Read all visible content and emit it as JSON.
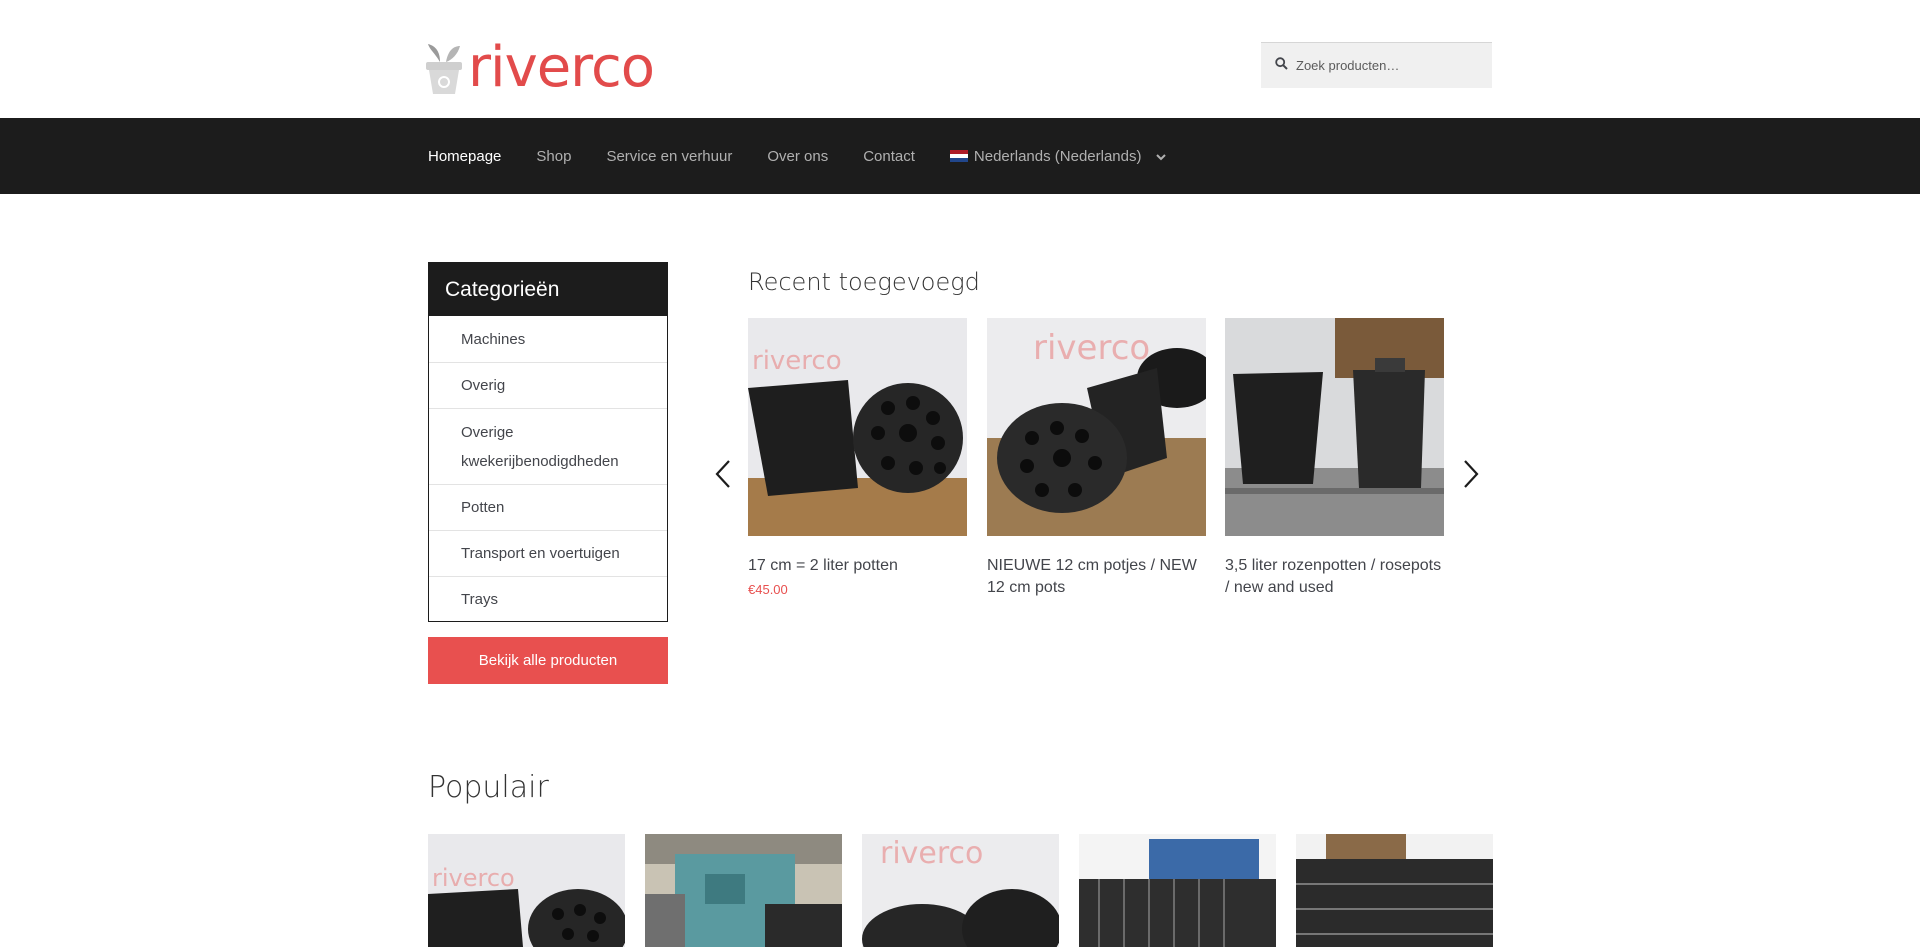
{
  "header": {
    "logo_text": "riverco",
    "search": {
      "placeholder": "Zoek producten…",
      "icon": "search-icon"
    }
  },
  "nav": {
    "items": [
      {
        "label": "Homepage",
        "active": true
      },
      {
        "label": "Shop"
      },
      {
        "label": "Service en verhuur"
      },
      {
        "label": "Over ons"
      },
      {
        "label": "Contact"
      }
    ],
    "language": {
      "label": "Nederlands (Nederlands)",
      "icon": "chevron-down-icon"
    }
  },
  "sidebar": {
    "title": "Categorieën",
    "categories": [
      "Machines",
      "Overig",
      "Overige kwekerijbenodigdheden",
      "Potten",
      "Transport en voertuigen",
      "Trays"
    ],
    "button_label": "Bekijk alle producten"
  },
  "recent": {
    "title": "Recent toegevoegd",
    "products": [
      {
        "name": "17 cm = 2 liter potten",
        "price": "€45.00"
      },
      {
        "name": "NIEUWE 12 cm potjes / NEW 12 cm pots",
        "price": ""
      },
      {
        "name": "3,5 liter rozenpotten / rosepots / new and used",
        "price": ""
      }
    ]
  },
  "popular": {
    "title": "Populair"
  },
  "colors": {
    "brand": "#e24b4b",
    "accent_button": "#e8504f",
    "nav_bg": "#1c1c1c"
  }
}
